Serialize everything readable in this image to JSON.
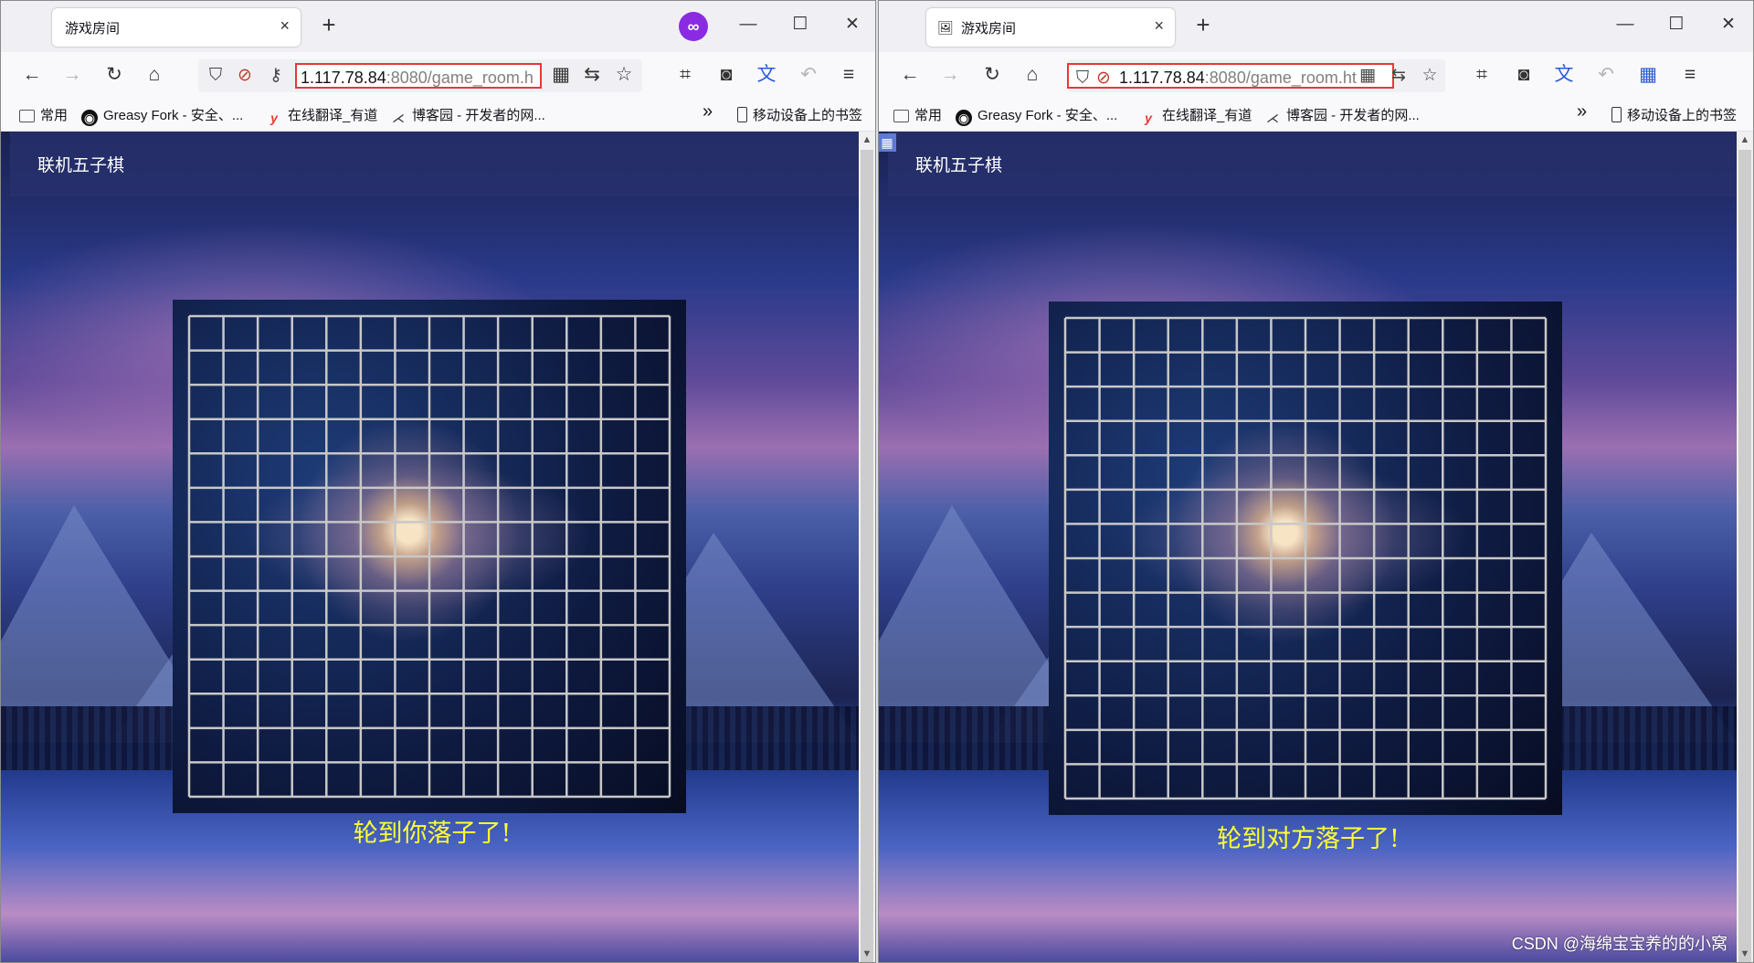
{
  "left": {
    "tab_title": "游戏房间",
    "url_host": "1.117.78.84",
    "url_rest": ":8080/game_room.h",
    "status": "轮到你落子了!"
  },
  "right": {
    "tab_title": "游戏房间",
    "url_host": "1.117.78.84",
    "url_rest": ":8080/game_room.ht",
    "status": "轮到对方落子了!"
  },
  "tab_close": "×",
  "new_tab": "+",
  "window_controls": {
    "minimize": "—",
    "maximize": "☐",
    "close": "✕"
  },
  "bookmarks": {
    "common": "常用",
    "greasy": "Greasy Fork - 安全、...",
    "youdao": "在线翻译_有道",
    "cnblogs": "博客园 - 开发者的网...",
    "more": "»",
    "mobile": "移动设备上的书签"
  },
  "page": {
    "title": "联机五子棋"
  },
  "board": {
    "lines": 15
  },
  "watermark": "CSDN @海绵宝宝养的的小窝",
  "colors": {
    "status_text": "#ffff33",
    "url_highlight": "#e53935"
  },
  "icons": [
    "back-icon",
    "forward-icon",
    "reload-icon",
    "home-icon",
    "shield-icon",
    "lock-icon",
    "key-icon",
    "qr-icon",
    "translate-icon",
    "star-icon",
    "crop-icon",
    "menu-icon"
  ]
}
